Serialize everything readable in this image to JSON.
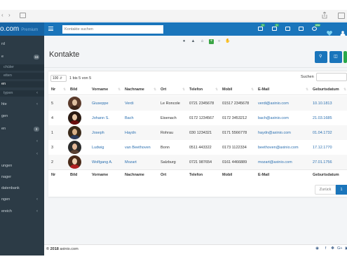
{
  "browser": {
    "share_icon": "share-icon",
    "tabs_icon": "tabs-icon"
  },
  "brand": {
    "name": "o.com",
    "plan": "Premium"
  },
  "header": {
    "search_placeholder": "Kontakte suchen",
    "icons": [
      {
        "name": "calendar-icon",
        "badge": "1"
      },
      {
        "name": "calendar-add-icon",
        "badge": "1"
      },
      {
        "name": "list-icon",
        "badge": ""
      },
      {
        "name": "card-icon",
        "badge": ""
      },
      {
        "name": "id-card-icon",
        "badge": ""
      },
      {
        "name": "whatsapp-icon",
        "badge": "new"
      },
      {
        "name": "heart-icon",
        "badge": ""
      },
      {
        "name": "user-icon",
        "badge": ""
      },
      {
        "name": "gear-icon",
        "badge": ""
      }
    ]
  },
  "sidebar": {
    "items": [
      {
        "label": "rd",
        "type": "main",
        "badge": "",
        "chevron": false
      },
      {
        "label": "e",
        "type": "main",
        "badge": "16",
        "chevron": false
      },
      {
        "label": "chüler",
        "type": "sub",
        "badge": "",
        "chevron": false
      },
      {
        "label": "eiten",
        "type": "sub",
        "badge": "",
        "chevron": false
      },
      {
        "label": "en",
        "type": "active",
        "badge": "",
        "chevron": false
      },
      {
        "label": "typen",
        "type": "sub",
        "badge": "",
        "chevron": true
      },
      {
        "label": "hte",
        "type": "main",
        "badge": "",
        "chevron": true
      },
      {
        "label": "gen",
        "type": "main",
        "badge": "",
        "chevron": false
      },
      {
        "label": "en",
        "type": "main",
        "badge": "3",
        "chevron": false
      },
      {
        "label": "",
        "type": "main",
        "badge": "",
        "chevron": true
      },
      {
        "label": "",
        "type": "main",
        "badge": "",
        "chevron": true
      },
      {
        "label": "ungen",
        "type": "main",
        "badge": "",
        "chevron": false
      },
      {
        "label": "nager",
        "type": "main",
        "badge": "",
        "chevron": false
      },
      {
        "label": "datenbank",
        "type": "main",
        "badge": "",
        "chevron": false
      },
      {
        "label": "ngen",
        "type": "main",
        "badge": "",
        "chevron": true
      },
      {
        "label": "ereich",
        "type": "main",
        "badge": "",
        "chevron": true
      }
    ]
  },
  "toolbar_icons": [
    "group-icon",
    "graduation-cap-icon",
    "institution-icon",
    "plus-icon",
    "search-icon",
    "hand-icon"
  ],
  "page": {
    "title": "Kontakte",
    "buttons": [
      {
        "name": "search-button",
        "icon": "search-icon"
      },
      {
        "name": "columns-button",
        "icon": "columns-icon"
      },
      {
        "name": "add-button",
        "icon": "plus-icon"
      }
    ]
  },
  "table": {
    "length": "100",
    "info": "1 bis 5 von 5",
    "search_label": "Suchen",
    "columns": [
      "Nr",
      "Bild",
      "Vorname",
      "Nachname",
      "Ort",
      "Telefon",
      "Mobil",
      "E-Mail",
      "Geburtsdatum"
    ],
    "rows": [
      {
        "nr": "5",
        "vorname": "Giuseppe",
        "nachname": "Verdi",
        "ort": "Le Roncole",
        "telefon": "0721 2345678",
        "mobil": "01517 2345678",
        "email": "verdi@axinio.com",
        "geburtsdatum": "10.10.1813"
      },
      {
        "nr": "4",
        "vorname": "Johann S.",
        "nachname": "Bach",
        "ort": "Eisenach",
        "telefon": "0172 1234567",
        "mobil": "0172 3453212",
        "email": "bach@axinio.com",
        "geburtsdatum": "21.03.1685"
      },
      {
        "nr": "1",
        "vorname": "Joseph",
        "nachname": "Haydn",
        "ort": "Rohrau",
        "telefon": "030 1234321",
        "mobil": "0171 5566778",
        "email": "haydn@axinio.com",
        "geburtsdatum": "01.04.1732"
      },
      {
        "nr": "3",
        "vorname": "Ludwig",
        "nachname": "van Beethoven",
        "ort": "Bonn",
        "telefon": "0511 443322",
        "mobil": "0173 1122334",
        "email": "beethoven@axinio.com",
        "geburtsdatum": "17.12.1770"
      },
      {
        "nr": "2",
        "vorname": "Wolfgang A.",
        "nachname": "Mozart",
        "ort": "Salzburg",
        "telefon": "0721 987654",
        "mobil": "0161 4466889",
        "email": "mozart@axinio.com",
        "geburtsdatum": "27.01.1756"
      }
    ],
    "pagination": {
      "prev": "Zurück",
      "current": "1"
    }
  },
  "footer": {
    "copyright_year": "© 2018",
    "company": "axinio.com",
    "social_icons": [
      "wordpress-icon",
      "facebook-icon",
      "twitter-icon",
      "google-plus-icon",
      "instagram-icon"
    ]
  },
  "colors": {
    "primary": "#1a75bb",
    "sidebar": "#2c3b46",
    "success": "#29a84a",
    "link": "#2a6fb0"
  }
}
